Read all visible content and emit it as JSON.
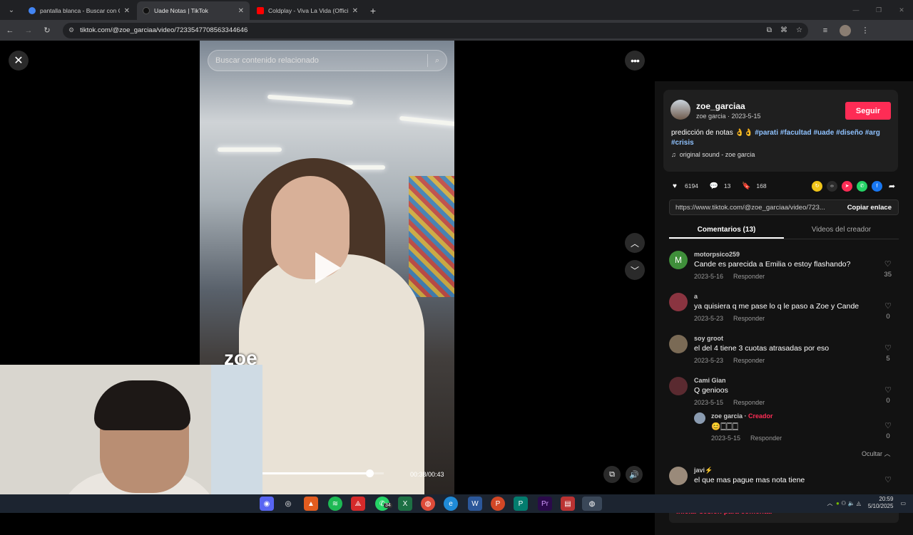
{
  "browser": {
    "tabs": [
      {
        "title": "pantalla blanca - Buscar con Go",
        "favicon_color": "#4285f4"
      },
      {
        "title": "Uade Notas | TikTok",
        "favicon_color": "#111111"
      },
      {
        "title": "Coldplay - Viva La Vida (Officia",
        "favicon_color": "#ff0000"
      }
    ],
    "url": "tiktok.com/@zoe_garciaa/video/7233547708563344646"
  },
  "video": {
    "search_placeholder": "Buscar contenido relacionado",
    "caption_overlay": "zoe",
    "time": "00:38/00:43",
    "progress": 0.88
  },
  "post": {
    "username": "zoe_garciaa",
    "subline": "zoe garcia · 2023-5-15",
    "follow_label": "Seguir",
    "description_prefix": "predicción de notas 👌👌 ",
    "tags": [
      "#parati",
      "#facultad",
      "#uade",
      "#diseño",
      "#arg",
      "#crisis"
    ],
    "sound": "original sound - zoe garcia",
    "likes": "6194",
    "comments": "13",
    "saves": "168",
    "link": "https://www.tiktok.com/@zoe_garciaa/video/723...",
    "copy_label": "Copiar enlace",
    "tab_comments": "Comentarios (13)",
    "tab_creator": "Videos del creador"
  },
  "comments": [
    {
      "user": "motorpsico259",
      "text": "Cande es parecida a Emilia o estoy flashando?",
      "date": "2023-5-16",
      "reply": "Responder",
      "likes": "35",
      "avatar_letter": "M",
      "avatar_color": "#3f8f3a"
    },
    {
      "user": "a",
      "text": "ya quisiera q me pase lo q le paso a Zoe y Cande",
      "date": "2023-5-23",
      "reply": "Responder",
      "likes": "0",
      "avatar_letter": "",
      "avatar_color": "#8a3440"
    },
    {
      "user": "soy groot",
      "text": "el del 4 tiene 3 cuotas atrasadas por eso",
      "date": "2023-5-23",
      "reply": "Responder",
      "likes": "5",
      "avatar_letter": "",
      "avatar_color": "#7a6a55"
    },
    {
      "user": "Cami Gian",
      "text": "Q genioos",
      "date": "2023-5-15",
      "reply": "Responder",
      "likes": "0",
      "avatar_letter": "",
      "avatar_color": "#5a2a30"
    }
  ],
  "reply": {
    "user": "zoe garcia",
    "badge": "Creador",
    "text": "😊🀆🀆🀆",
    "date": "2023-5-15",
    "reply": "Responder",
    "likes": "0"
  },
  "hide_label": "Ocultar",
  "last_comment": {
    "user": "javi⚡",
    "text": "el que mas pague mas nota tiene"
  },
  "login_prompt": "Iniciar sesión para comentar",
  "taskbar": {
    "time": "20:59",
    "date": "5/10/2025",
    "whatsapp_badge": "34"
  }
}
